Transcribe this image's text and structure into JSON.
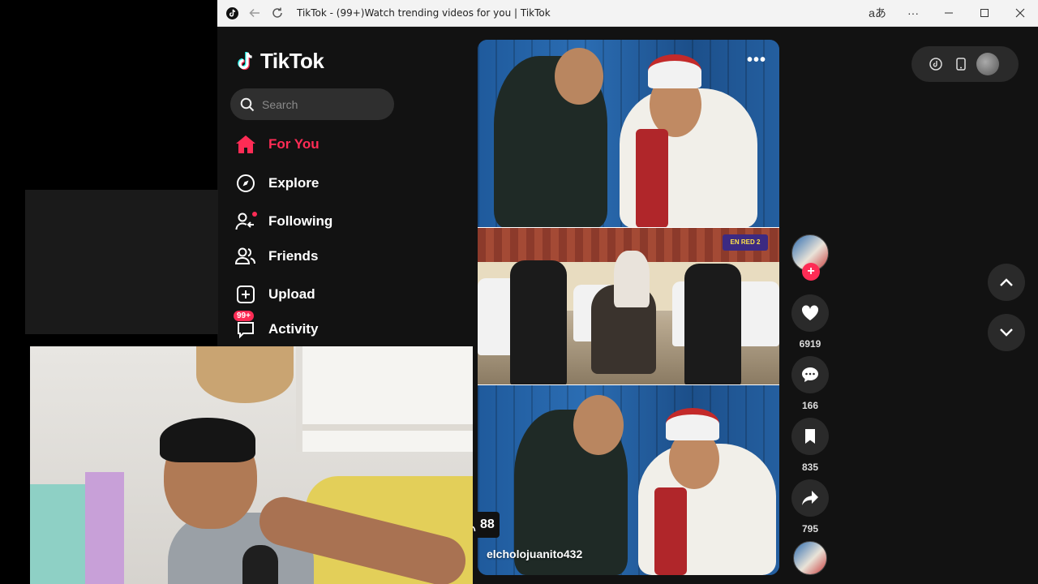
{
  "window": {
    "title": "TikTok - (99+)Watch trending videos for you | TikTok",
    "read_aloud_glyph": "aあ",
    "more_glyph": "···"
  },
  "sidebar": {
    "logo": "TikTok",
    "search_placeholder": "Search",
    "items": [
      {
        "label": "For You",
        "icon": "home-icon",
        "active": true
      },
      {
        "label": "Explore",
        "icon": "compass-icon"
      },
      {
        "label": "Following",
        "icon": "following-icon"
      },
      {
        "label": "Friends",
        "icon": "friends-icon"
      },
      {
        "label": "Upload",
        "icon": "upload-icon"
      },
      {
        "label": "Activity",
        "icon": "activity-icon",
        "badge": "99+"
      }
    ]
  },
  "video": {
    "author": "elcholojuanito432",
    "viewers": "88",
    "overlay_text": "EN RED 2"
  },
  "actions": {
    "likes": "6919",
    "comments": "166",
    "saves": "835",
    "shares": "795"
  },
  "colors": {
    "accent": "#fe2c55",
    "background": "#121212",
    "panel": "#2a2a2a"
  }
}
